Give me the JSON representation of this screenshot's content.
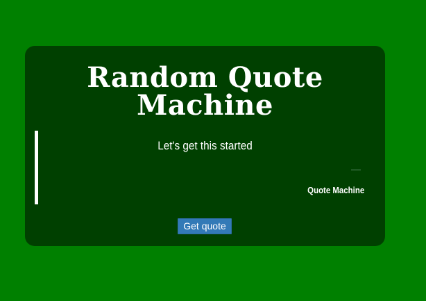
{
  "card": {
    "title_line1": "Random Quote",
    "title_line2": "Machine"
  },
  "quote": {
    "text": "Let's get this started",
    "author": "Quote Machine"
  },
  "actions": {
    "get_quote_label": "Get quote"
  },
  "colors": {
    "page_background": "#008000",
    "card_background": "#004000",
    "text": "#ffffff",
    "button": "#337ab7"
  }
}
